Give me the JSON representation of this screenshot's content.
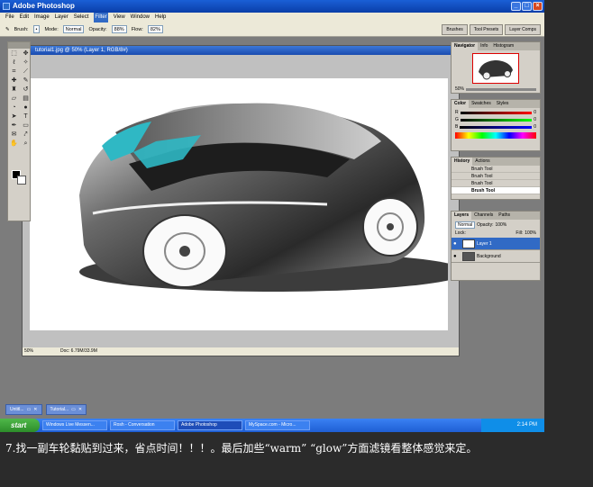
{
  "app": {
    "title": "Adobe Photoshop"
  },
  "menu": [
    "File",
    "Edit",
    "Image",
    "Layer",
    "Select",
    "Filter",
    "View",
    "Window",
    "Help"
  ],
  "active_menu": "Filter",
  "options": {
    "brush_label": "Brush:",
    "mode_label": "Mode:",
    "mode_value": "Normal",
    "opacity_label": "Opacity:",
    "opacity_value": "88%",
    "flow_label": "Flow:",
    "flow_value": "82%"
  },
  "palette_well": [
    "Brushes",
    "Tool Presets",
    "Layer Comps"
  ],
  "document": {
    "title": "tutorial1.jpg @ 50% (Layer 1, RGB/8#)",
    "zoom": "50%",
    "doc_size": "Doc: 6.79M/33.9M"
  },
  "navigator": {
    "tabs": [
      "Navigator",
      "Info",
      "Histogram"
    ],
    "zoom": "50%"
  },
  "color": {
    "tabs": [
      "Color",
      "Swatches",
      "Styles"
    ],
    "channels": [
      "R",
      "G",
      "B"
    ],
    "r_val": "0",
    "g_val": "0",
    "b_val": "0"
  },
  "history": {
    "tabs": [
      "History",
      "Actions"
    ],
    "items": [
      "Brush Tool",
      "Brush Tool",
      "Brush Tool",
      "Brush Tool"
    ]
  },
  "layers": {
    "tabs": [
      "Layers",
      "Channels",
      "Paths"
    ],
    "blend": "Normal",
    "opacity_label": "Opacity:",
    "opacity_value": "100%",
    "lock_label": "Lock:",
    "fill_label": "Fill:",
    "fill_value": "100%",
    "rows": [
      "Layer 1",
      "Background"
    ]
  },
  "mini_windows": [
    "Untitl...",
    "Tutorial..."
  ],
  "taskbar": {
    "start": "start",
    "tasks": [
      "Windows Live Messen...",
      "Rosh - Conversation",
      "Adobe Photoshop",
      "MySpace.com - Micro..."
    ],
    "active_task": 2,
    "clock": "2:14 PM"
  },
  "caption": "7.找一副车轮黏贴到过来，省点时间！！！。最后加些“warm” “glow”方面滤镜看整体感觉来定。",
  "colors": {
    "titlebar": "#0a3ea8",
    "taskbar": "#1f5fd4",
    "start": "#2d8d2a",
    "car_glass": "#2fb8c4"
  }
}
